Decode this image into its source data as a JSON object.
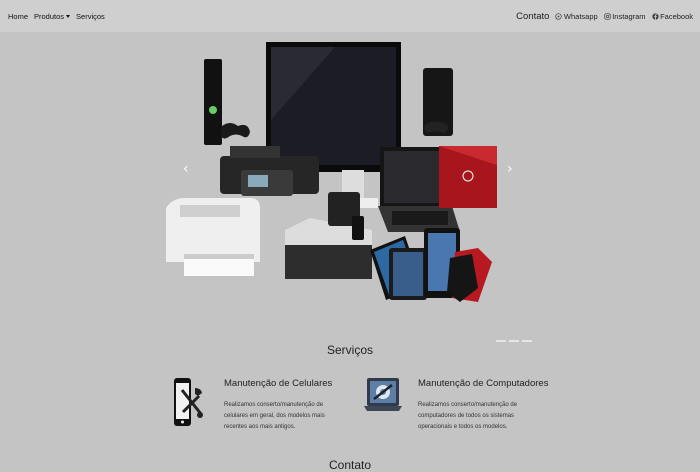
{
  "nav": {
    "home": "Home",
    "produtos": "Produtos",
    "servicos": "Serviços",
    "contato": "Contato",
    "whatsapp": "Whatsapp",
    "instagram": "Instagram",
    "facebook": "Facebook"
  },
  "carousel": {
    "prev_icon": "chevron-left-icon",
    "next_icon": "chevron-right-icon",
    "slide_count": 3,
    "active_slide": 1
  },
  "services": {
    "title": "Serviços",
    "items": [
      {
        "icon": "phone-repair-icon",
        "title": "Manutenção de Celulares",
        "description": "Realizamos conserto/manutenção de celulares em geral, dos modelos mais recentes aos mais antigos."
      },
      {
        "icon": "laptop-gear-icon",
        "title": "Manutenção de Computadores",
        "description": "Realizamos conserto/manutenção de computadores de todos os sistemas operacionais e todos os modelos."
      }
    ]
  },
  "contact": {
    "title": "Contato"
  }
}
